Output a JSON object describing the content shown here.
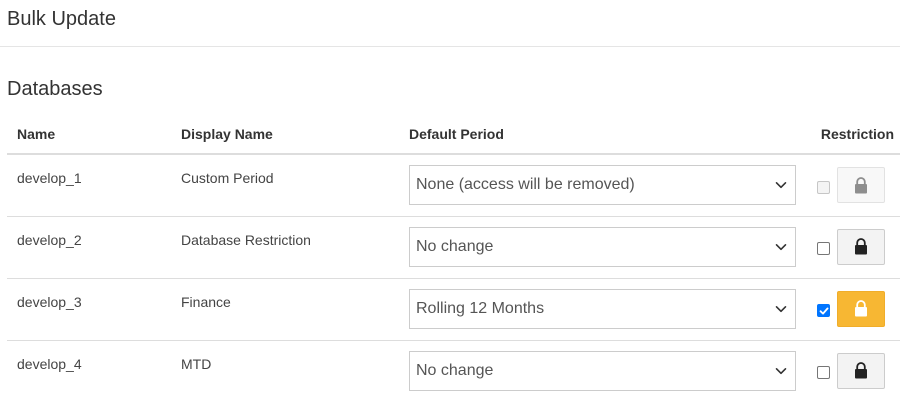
{
  "header": {
    "title": "Bulk Update"
  },
  "section": {
    "title": "Databases"
  },
  "table": {
    "columns": [
      "Name",
      "Display Name",
      "Default Period",
      "Restriction"
    ],
    "rows": [
      {
        "name": "develop_1",
        "display_name": "Custom Period",
        "default_period": "None (access will be removed)",
        "restriction_checked": false,
        "restriction_disabled": true,
        "lock_icon": "lock-icon"
      },
      {
        "name": "develop_2",
        "display_name": "Database Restriction",
        "default_period": "No change",
        "restriction_checked": false,
        "restriction_disabled": false,
        "lock_icon": "lock-icon"
      },
      {
        "name": "develop_3",
        "display_name": "Finance",
        "default_period": "Rolling 12 Months",
        "restriction_checked": true,
        "restriction_disabled": false,
        "lock_icon": "lock-icon"
      },
      {
        "name": "develop_4",
        "display_name": "MTD",
        "default_period": "No change",
        "restriction_checked": false,
        "restriction_disabled": false,
        "lock_icon": "lock-icon"
      }
    ]
  },
  "colors": {
    "accent_checkbox": "#0075ff",
    "lock_active": "#f7b733",
    "lock_default": "#f3f3f3"
  }
}
